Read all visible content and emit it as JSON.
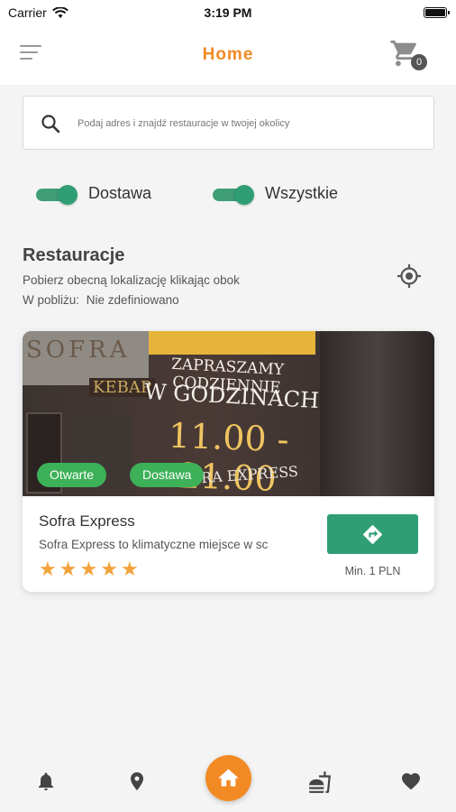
{
  "status_bar": {
    "carrier": "Carrier",
    "time": "3:19 PM"
  },
  "header": {
    "title": "Home",
    "cart_count": "0"
  },
  "search": {
    "placeholder": "Podaj adres i znajdź restauracje w twojej okolicy"
  },
  "filters": [
    {
      "label": "Dostawa",
      "on": true
    },
    {
      "label": "Wszystkie",
      "on": true
    }
  ],
  "section": {
    "title": "Restauracje",
    "subtitle": "Pobierz obecną lokalizację klikając obok",
    "nearby_label": "W pobliżu:",
    "nearby_value": "Nie zdefiniowano"
  },
  "restaurant": {
    "name": "Sofra Express",
    "description": "Sofra Express to klimatyczne miejsce w sc",
    "rating": 5,
    "rating_max": 5,
    "min_order": "Min. 1 PLN",
    "badges": {
      "open": "Otwarte",
      "delivery": "Dostawa"
    },
    "image_text": {
      "sign": "SOFRA",
      "kebap": "KEBAP",
      "line1": "ZAPRASZAMY CODZIENNIE",
      "line2": "W GODZINACH",
      "hours": "11.00 - 21.00",
      "line3": "RA EXPRESS"
    }
  },
  "nav": {
    "items": [
      "bell-icon",
      "location-pin-icon",
      "home-icon",
      "restaurant-icon",
      "heart-icon"
    ],
    "active": "home-icon"
  },
  "colors": {
    "accent": "#f08a24",
    "green": "#2f9e74",
    "badge_green": "#3db158",
    "star": "#f2a33a"
  }
}
